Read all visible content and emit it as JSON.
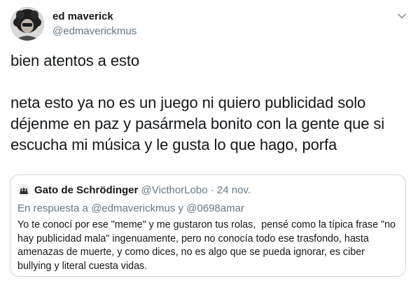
{
  "tweet": {
    "author": {
      "name": "ed maverick",
      "handle": "@edmaverickmus"
    },
    "text": "bien atentos a esto\n\nneta esto ya no es un juego ni quiero publicidad solo déjenme en paz y pasármela bonito con la gente que si escucha mi música y le gusta lo que hago, porfa",
    "menu_icon": "chevron-down-icon"
  },
  "quoted": {
    "author_name": "Gato de Schrödinger",
    "author_handle": "@VicthorLobo",
    "separator": "·",
    "date": "24 nov.",
    "reply_to": "En respuesta a @edmaverickmus y @0698amar",
    "text": "Yo te conocí por ese \"meme\" y me gustaron tus rolas,  pensé como la típica frase \"no hay publicidad mala\" ingenuamente, pero no conocía todo ese trasfondo, hasta amenazas de muerte, y como dices, no es algo que se pueda ignorar, es ciber bullying y literal cuesta vidas."
  },
  "colors": {
    "text": "#14171a",
    "secondary": "#657786",
    "border": "#ccd6dd"
  }
}
